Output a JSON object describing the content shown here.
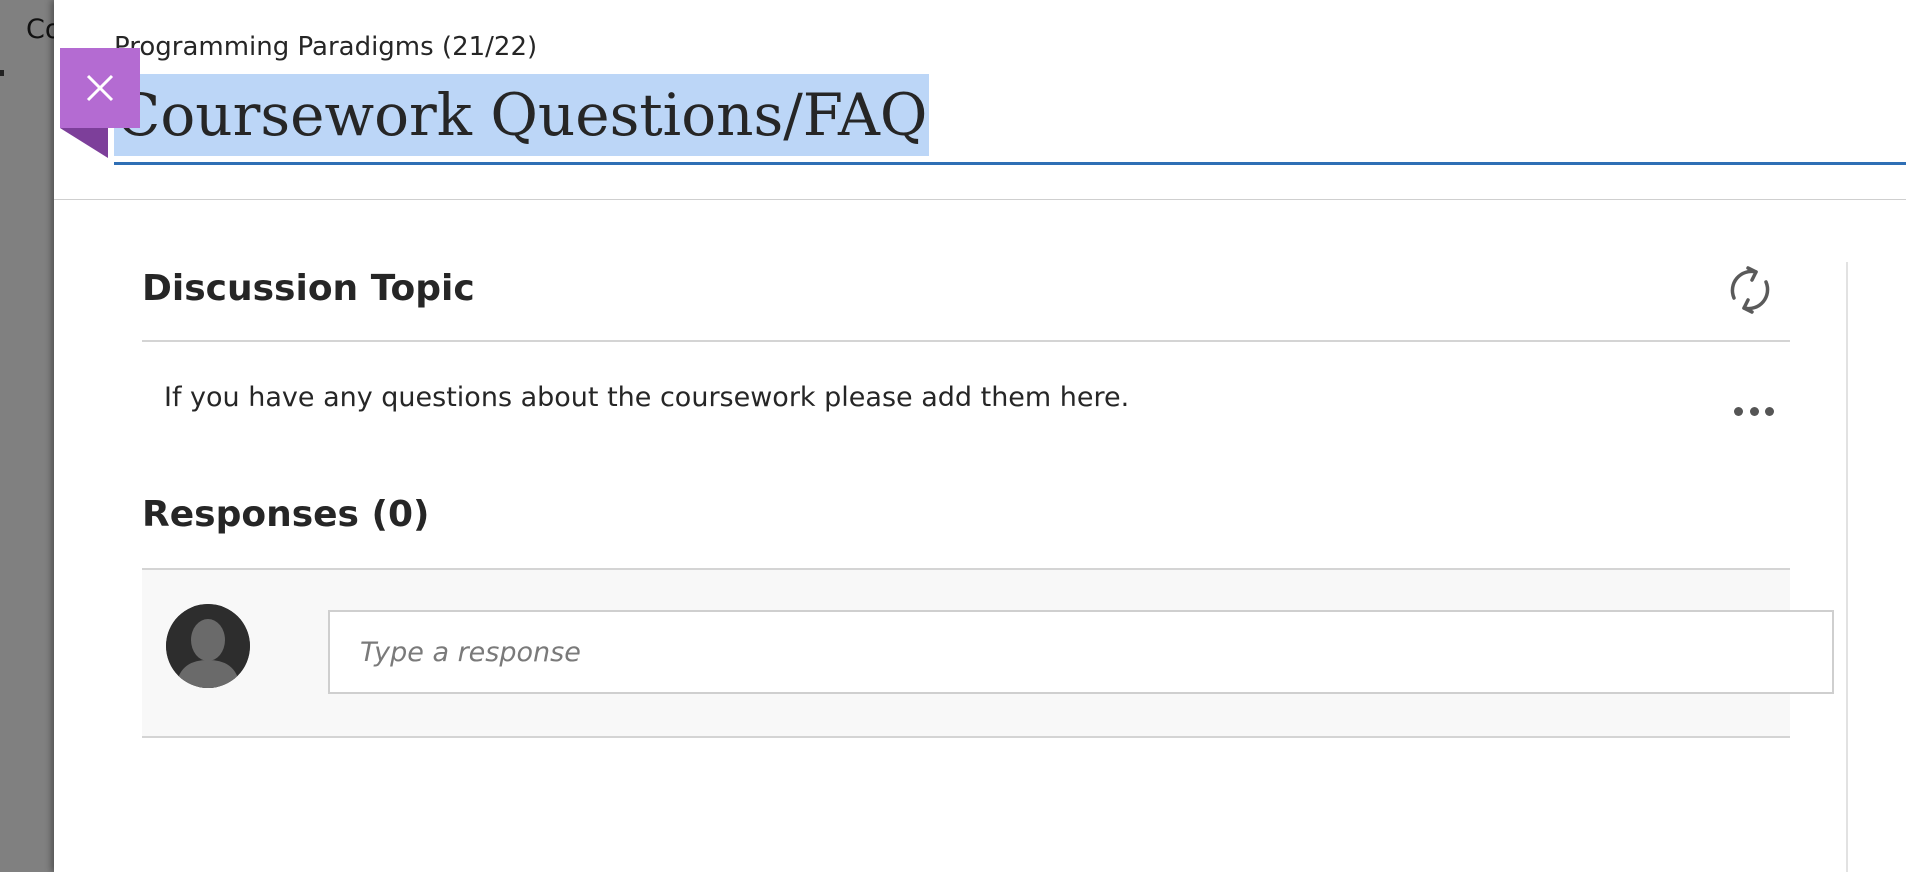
{
  "background_page": {
    "peek_text": "Co"
  },
  "header": {
    "course_name": "Programming Paradigms (21/22)",
    "title": "Coursework Questions/FAQ",
    "close_icon": "close-icon"
  },
  "topic": {
    "heading": "Discussion Topic",
    "refresh_icon": "refresh-icon",
    "body": "If you have any questions about the coursework please add them here.",
    "more_icon": "more-options-icon"
  },
  "responses": {
    "heading": "Responses (0)",
    "input_placeholder": "Type a response",
    "avatar_icon": "user-avatar-icon"
  },
  "colors": {
    "accent_purple": "#b46bd2",
    "title_highlight": "#bcd6f7",
    "title_underline": "#2f6fb5"
  }
}
